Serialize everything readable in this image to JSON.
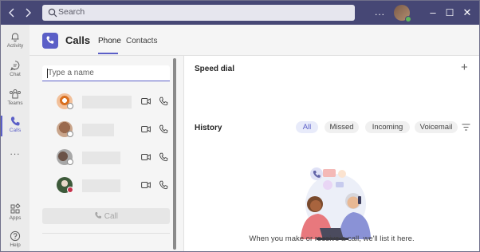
{
  "titlebar": {
    "search_placeholder": "Search",
    "more_label": "...",
    "back_icon": "chevron-left-icon",
    "forward_icon": "chevron-right-icon",
    "minimize_label": "–",
    "maximize_label": "☐",
    "close_label": "✕"
  },
  "rail": {
    "items": [
      {
        "label": "Activity",
        "icon": "bell-icon"
      },
      {
        "label": "Chat",
        "icon": "chat-icon"
      },
      {
        "label": "Teams",
        "icon": "teams-icon"
      },
      {
        "label": "Calls",
        "icon": "phone-icon"
      }
    ],
    "more_label": "...",
    "bottom": [
      {
        "label": "Apps",
        "icon": "apps-icon"
      },
      {
        "label": "Help",
        "icon": "help-icon"
      }
    ]
  },
  "header": {
    "title": "Calls",
    "tabs": [
      {
        "label": "Phone",
        "active": true
      },
      {
        "label": "Contacts",
        "active": false
      }
    ]
  },
  "contacts_panel": {
    "input_placeholder": "Type a name",
    "call_button_label": "Call"
  },
  "speed_dial": {
    "title": "Speed dial",
    "add_label": "+"
  },
  "history": {
    "title": "History",
    "filters": [
      "All",
      "Missed",
      "Incoming",
      "Voicemail"
    ],
    "active_filter": "All",
    "empty_message": "When you make or receive a call, we'll list it here."
  },
  "colors": {
    "titlebar": "#464775",
    "accent": "#5b5fc7",
    "rail": "#ebebeb",
    "status_available": "#5fb75c",
    "status_busy": "#c4314b"
  }
}
